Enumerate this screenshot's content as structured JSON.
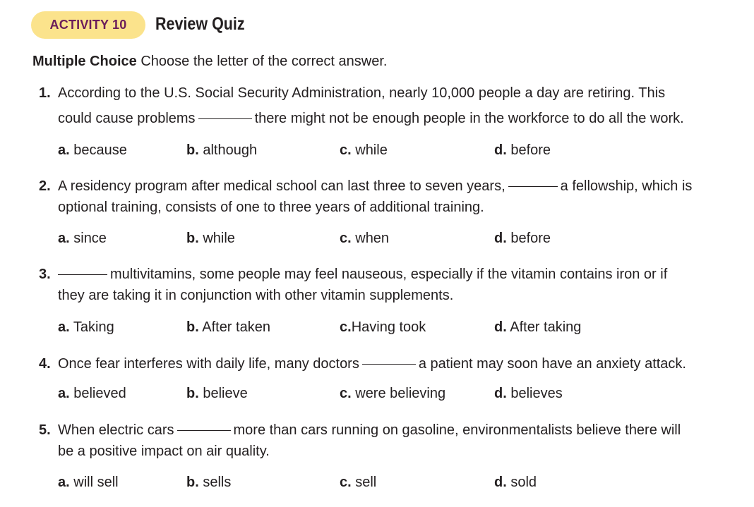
{
  "header": {
    "badge": "ACTIVITY 10",
    "title": "Review Quiz"
  },
  "instructions": {
    "bold": "Multiple Choice",
    "text": " Choose the letter of the correct answer."
  },
  "questions": [
    {
      "num": "1.",
      "l1": "According to the U.S. Social Security Administration, nearly 10,000 people a day are retiring. This",
      "l2a": "could cause problems",
      "l2b": "there might not be enough people in the workforce to do all the work.",
      "opts": [
        {
          "l": "a.",
          "t": " because"
        },
        {
          "l": "b.",
          "t": " although"
        },
        {
          "l": "c.",
          "t": " while"
        },
        {
          "l": "d.",
          "t": " before"
        }
      ]
    },
    {
      "num": "2.",
      "l1a": "A residency program after medical school can last three to seven years,",
      "l1b": "a fellowship, which is",
      "l2": "optional training, consists of one to three years of additional training.",
      "opts": [
        {
          "l": "a.",
          "t": " since"
        },
        {
          "l": "b.",
          "t": " while"
        },
        {
          "l": "c.",
          "t": " when"
        },
        {
          "l": "d.",
          "t": " before"
        }
      ]
    },
    {
      "num": "3.",
      "l1": "multivitamins, some people may feel nauseous, especially if the vitamin contains iron or if",
      "l2": "they are taking it in conjunction with other vitamin supplements.",
      "opts": [
        {
          "l": "a.",
          "t": " Taking"
        },
        {
          "l": "b.",
          "t": " After taken"
        },
        {
          "l": "c.",
          "t": "Having took"
        },
        {
          "l": "d.",
          "t": " After taking"
        }
      ]
    },
    {
      "num": "4.",
      "l1a": "Once fear interferes with daily life, many doctors",
      "l1b": "a patient may soon have an anxiety attack.",
      "opts": [
        {
          "l": "a.",
          "t": " believed"
        },
        {
          "l": "b.",
          "t": " believe"
        },
        {
          "l": "c.",
          "t": " were believing"
        },
        {
          "l": "d.",
          "t": " believes"
        }
      ]
    },
    {
      "num": "5.",
      "l1a": "When electric cars",
      "l1b": "more than cars running on gasoline, environmentalists believe there will",
      "l2": "be a positive impact on air quality.",
      "opts": [
        {
          "l": "a.",
          "t": " will sell"
        },
        {
          "l": "b.",
          "t": " sells"
        },
        {
          "l": "c.",
          "t": " sell"
        },
        {
          "l": "d.",
          "t": " sold"
        }
      ]
    }
  ]
}
